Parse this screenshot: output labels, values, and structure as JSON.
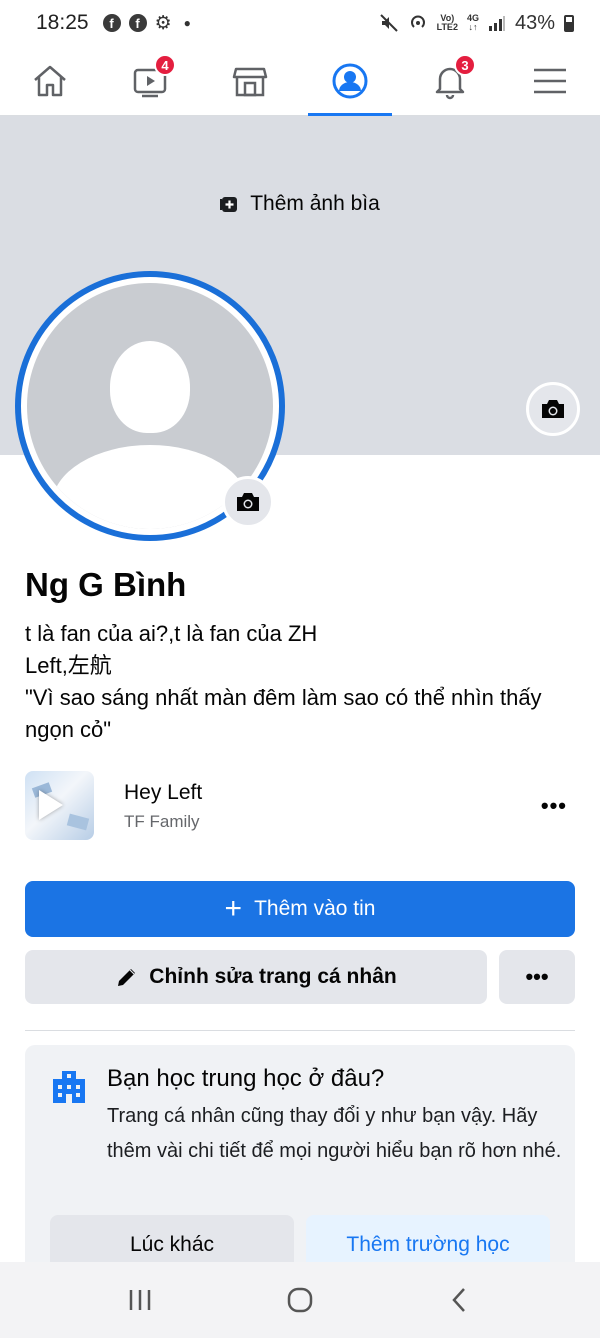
{
  "status_bar": {
    "time": "18:25",
    "network_top": "Vo)",
    "network_bottom": "LTE2",
    "data_top": "4G",
    "data_bottom": "↓↑",
    "battery": "43%"
  },
  "nav": {
    "watch_badge": "4",
    "notifications_badge": "3"
  },
  "cover": {
    "add_cover_label": "Thêm ảnh bìa"
  },
  "profile": {
    "name": "Ng G Bình",
    "bio_lines": [
      "t là fan của ai?,t là fan của ZH",
      "Left,左航",
      "\"Vì sao sáng nhất màn đêm làm sao có thể nhìn thấy ngọn cỏ\""
    ]
  },
  "music": {
    "title": "Hey Left",
    "artist": "TF Family"
  },
  "actions": {
    "add_story_label": "Thêm vào tin",
    "edit_profile_label": "Chỉnh sửa trang cá nhân"
  },
  "school_prompt": {
    "title": "Bạn học trung học ở đâu?",
    "description": "Trang cá nhân cũng thay đổi y như bạn vậy. Hãy thêm vài chi tiết để mọi người hiểu bạn rõ hơn nhé.",
    "later_label": "Lúc khác",
    "add_school_label": "Thêm trường học"
  },
  "colors": {
    "brand": "#1877f2",
    "badge": "#e41e3f",
    "cover": "#dadde3"
  }
}
